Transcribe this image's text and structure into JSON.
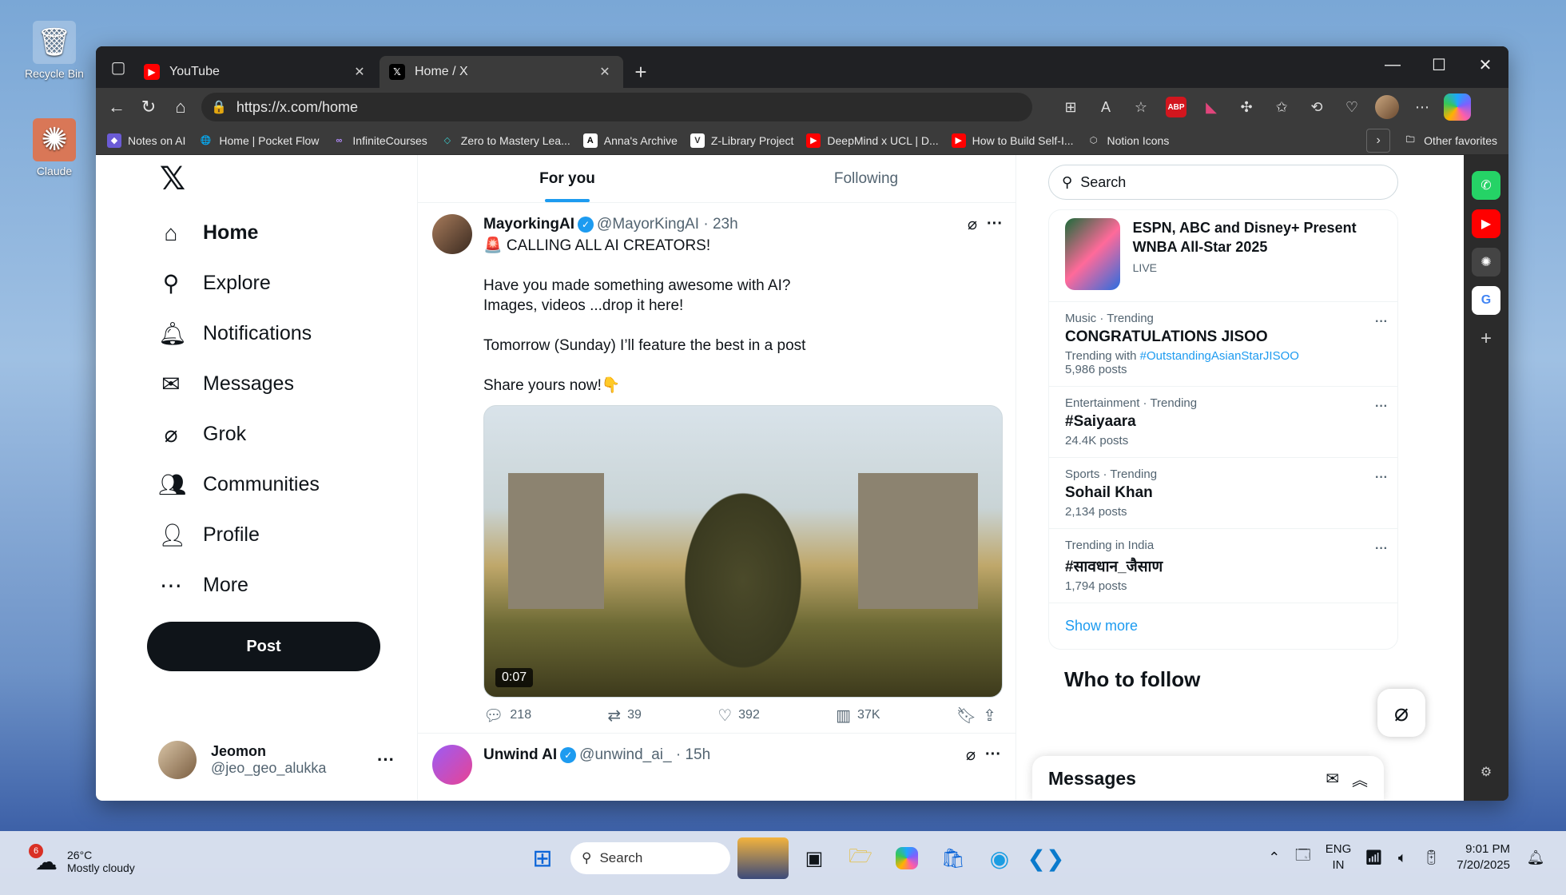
{
  "desktop": {
    "recycle_bin": "Recycle Bin",
    "claude": "Claude"
  },
  "browser": {
    "tabs": [
      {
        "title": "YouTube",
        "icon": "youtube-icon"
      },
      {
        "title": "Home / X",
        "icon": "x-icon"
      }
    ],
    "url": "https://x.com/home",
    "favorites": [
      "Notes on AI",
      "Home | Pocket Flow",
      "InfiniteCourses",
      "Zero to Mastery Lea...",
      "Anna's Archive",
      "Z-Library Project",
      "DeepMind x UCL | D...",
      "How to Build Self-I...",
      "Notion Icons"
    ],
    "other_favorites": "Other favorites"
  },
  "x": {
    "nav": [
      {
        "label": "Home",
        "icon": "home-icon"
      },
      {
        "label": "Explore",
        "icon": "search-icon"
      },
      {
        "label": "Notifications",
        "icon": "bell-icon"
      },
      {
        "label": "Messages",
        "icon": "mail-icon"
      },
      {
        "label": "Grok",
        "icon": "grok-icon"
      },
      {
        "label": "Communities",
        "icon": "communities-icon"
      },
      {
        "label": "Profile",
        "icon": "profile-icon"
      },
      {
        "label": "More",
        "icon": "more-circle-icon"
      }
    ],
    "post_label": "Post",
    "account": {
      "name": "Jeomon",
      "handle": "@jeo_geo_alukka"
    },
    "feed_tabs": [
      "For you",
      "Following"
    ],
    "tweets": [
      {
        "name": "MayorkingAI",
        "handle": "@MayorKingAI",
        "time": "23h",
        "text": "🚨 CALLING ALL AI CREATORS!\n\nHave you made something awesome with AI?\nImages, videos ...drop it here!\n\nTomorrow (Sunday) I’ll feature the best in a post\n\n Share yours now!👇",
        "duration": "0:07",
        "replies": "218",
        "reposts": "39",
        "likes": "392",
        "views": "37K"
      },
      {
        "name": "Unwind AI",
        "handle": "@unwind_ai_",
        "time": "15h"
      }
    ],
    "search_placeholder": "Search",
    "news": {
      "title": "ESPN, ABC and Disney+ Present WNBA All-Star 2025",
      "status": "LIVE"
    },
    "trends": [
      {
        "meta": "Music · Trending",
        "name": "CONGRATULATIONS JISOO",
        "with": "Trending with",
        "link": "#OutstandingAsianStarJISOO",
        "posts": "5,986 posts"
      },
      {
        "meta": "Entertainment · Trending",
        "name": "#Saiyaara",
        "posts": "24.4K posts"
      },
      {
        "meta": "Sports · Trending",
        "name": "Sohail Khan",
        "posts": "2,134 posts"
      },
      {
        "meta": "Trending in India",
        "name": "#सावधान_जैसाण",
        "posts": "1,794 posts"
      }
    ],
    "show_more": "Show more",
    "who_to_follow": "Who to follow",
    "messages_title": "Messages"
  },
  "taskbar": {
    "weather_temp": "26°C",
    "weather_desc": "Mostly cloudy",
    "weather_badge": "6",
    "search": "Search",
    "lang_top": "ENG",
    "lang_bottom": "IN",
    "time": "9:01 PM",
    "date": "7/20/2025"
  },
  "colors": {
    "x_blue": "#1d9bf0",
    "x_black": "#0f1419",
    "browser_chrome": "#3b3b3b"
  }
}
